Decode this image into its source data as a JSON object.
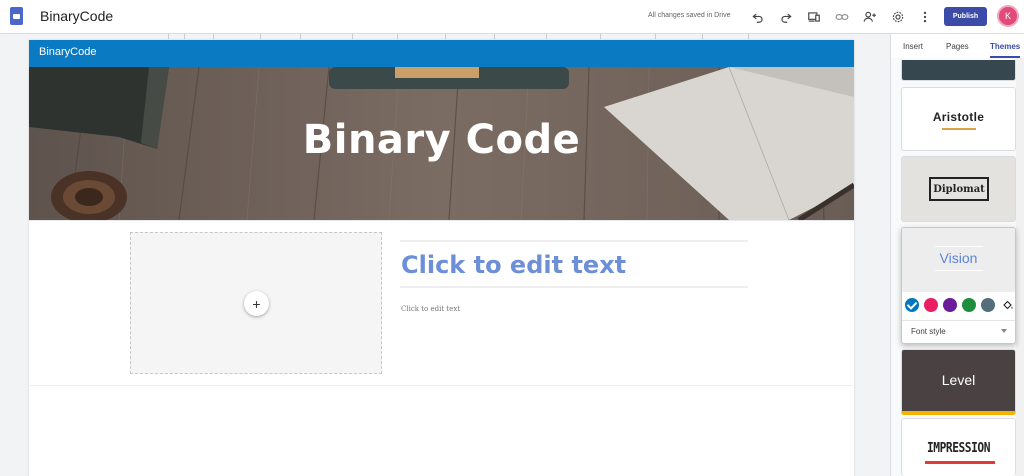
{
  "app": {
    "site_title": "BinaryCode",
    "save_status": "All changes saved in Drive",
    "publish_label": "Publish",
    "avatar_initial": "K",
    "toolbar_icons": [
      "undo-icon",
      "redo-icon",
      "preview-icon",
      "link-icon",
      "share-icon",
      "settings-icon",
      "more-icon"
    ]
  },
  "page": {
    "nav_title": "BinaryCode",
    "hero_title": "Binary Code",
    "heading_placeholder": "Click to edit text",
    "body_placeholder": "Click to edit text",
    "add_image_symbol": "+"
  },
  "panel": {
    "tabs": [
      "Insert",
      "Pages",
      "Themes"
    ],
    "active_tab": "Themes",
    "themes": {
      "aristotle": "Aristotle",
      "diplomat": "Diplomat",
      "vision": "Vision",
      "level": "Level",
      "impression": "IMPRESSION"
    },
    "color_swatches": [
      "#0277bd",
      "#e91e63",
      "#6a1b9a",
      "#1e8e3e",
      "#546e7a"
    ],
    "selected_swatch": "#0277bd",
    "font_style_label": "Font style"
  }
}
